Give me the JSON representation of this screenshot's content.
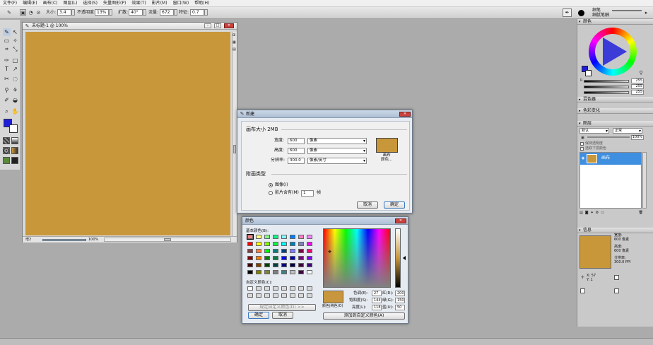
{
  "menu": [
    "文件(F)",
    "编辑(E)",
    "画布(C)",
    "图层(L)",
    "选择(S)",
    "矢量图形(P)",
    "效果(T)",
    "影片(M)",
    "窗口(W)",
    "帮助(H)"
  ],
  "options": {
    "size_label": "大小:",
    "size_value": "3.4",
    "opacity_label": "不透明度:",
    "opacity_value": "13%",
    "spread_label": "扩散:",
    "spread_value": "40°",
    "flow_label": "流量:",
    "flow_value": "672",
    "feature_label": "特征:",
    "feature_value": "0.7",
    "brush_name": "细笔",
    "brush_variant": "细腻笔触"
  },
  "document": {
    "title": "未标题-1 @ 100%",
    "status_label": "增2",
    "zoom": "100%",
    "canvas_color": "#c8973a"
  },
  "new_dialog": {
    "title": "新建",
    "size_label": "画布大小 2MB",
    "width_label": "宽度:",
    "width_value": "600",
    "width_unit": "像素",
    "height_label": "高度:",
    "height_value": "600",
    "height_unit": "像素",
    "res_label": "分辨率:",
    "res_value": "300.0",
    "res_unit": "像素/英寸",
    "swatch_label": "画布\n颜色...",
    "type_label": "附画类型",
    "opt_image": "图像(I)",
    "opt_movie": "影片含有(M)",
    "frames_value": "1",
    "frames_unit": "帧",
    "cancel": "取消",
    "ok": "确定"
  },
  "color_dialog": {
    "title": "颜色",
    "basic_label": "基本颜色(B):",
    "custom_label": "自定义颜色(C):",
    "define_btn": "规定自定义颜色(D) >>",
    "ok": "确定",
    "cancel": "取消",
    "solid_label": "颜色|纯色(O)",
    "hue_label": "色调(E):",
    "hue_value": "27",
    "sat_label": "饱和度(S):",
    "sat_value": "144",
    "lum_label": "亮度(L):",
    "lum_value": "118",
    "red_label": "红(R):",
    "red_value": "200",
    "green_label": "绿(G):",
    "green_value": "150",
    "blue_label": "蓝(U):",
    "blue_value": "50",
    "add_btn": "添加到自定义颜色(A)",
    "basic_colors": [
      "#ff8080",
      "#ffff80",
      "#80ff80",
      "#00ff80",
      "#80ffff",
      "#0080ff",
      "#ff80c0",
      "#ff80ff",
      "#ff0000",
      "#ffff00",
      "#80ff00",
      "#00ff40",
      "#00ffff",
      "#0080c0",
      "#8080c0",
      "#ff00ff",
      "#804040",
      "#ff8040",
      "#00ff00",
      "#008080",
      "#004080",
      "#8080ff",
      "#800040",
      "#ff0080",
      "#800000",
      "#ff8000",
      "#008000",
      "#008040",
      "#0000ff",
      "#0000a0",
      "#800080",
      "#8000ff",
      "#400000",
      "#804000",
      "#004000",
      "#004040",
      "#000080",
      "#000040",
      "#400040",
      "#400080",
      "#000000",
      "#808000",
      "#808040",
      "#808080",
      "#408080",
      "#c0c0c0",
      "#400040",
      "#ffffff"
    ]
  },
  "panels": {
    "color": "颜色",
    "rgb": [
      "255",
      "255",
      "255"
    ],
    "mixer": "混色器",
    "variation": "色彩变化",
    "layers": "图层",
    "blend_mode": "默认",
    "composite": "正常",
    "opacity_value": "100%",
    "preserve": "保持透明度",
    "pick_lower": "选取下层颜色",
    "layer_name": "画布",
    "info": "信息",
    "info_width": "宽度:\n600 像素",
    "info_height": "高度:\n600 像素",
    "info_res": "分辨率:\n300.0 PPI",
    "info_x": "X: 57",
    "info_y": "Y: 1"
  }
}
